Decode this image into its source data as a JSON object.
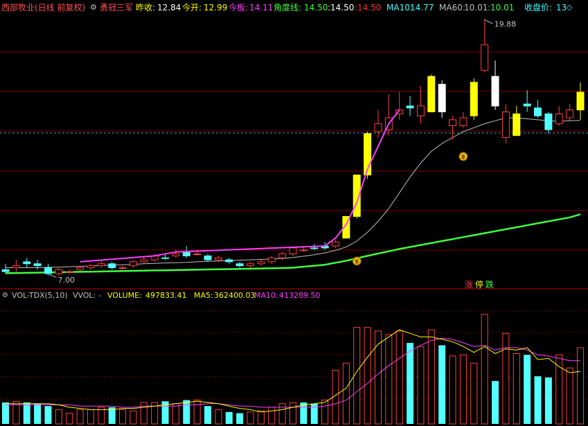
{
  "header": {
    "stock_name": "西部牧业(日线 前复权)",
    "strategy_icon": "gear-icon",
    "strategy_name": "勇冠三军",
    "prev_close_label": "昨收:",
    "prev_close_value": "12.84",
    "open_label": "今开:",
    "open_value": "12.99",
    "limit_label": "今板:",
    "limit_value": "14.11",
    "angle_label": "角度线:",
    "angle_value": "14.50",
    "colon_value": ":14.50",
    "val_red": ":14.50",
    "ma10_label": "MA10:",
    "ma10_value": "14.77",
    "ma60_label": "MA60:",
    "ma60_value": "10.01",
    "val_green": ":10.01",
    "close_label": "收盘价:",
    "close_value": "13",
    "diamond_icon": "diamond-icon"
  },
  "annotations": {
    "high_label": "19.88",
    "low_label": "7.00",
    "buy_icon": "money-bag-icon",
    "zhang": "涨",
    "ting": "停",
    "die": "跌"
  },
  "volume_header": {
    "title": "VOL-TDX(5,10)",
    "vvol": "VVOL: -",
    "volume_label": "VOLUME:",
    "volume_value": "497833.41",
    "ma5_label": "MA5:",
    "ma5_value": "362400.03",
    "ma10_label": "MA10:",
    "ma10_value": "413289.50"
  },
  "colors": {
    "up": "#ff4040",
    "down": "#54ffff",
    "yellow": "#ffff00",
    "white": "#ffffff",
    "ma60": "#40ff40",
    "angle": "#ff3fff",
    "grid": "#800000"
  },
  "chart_data": {
    "type": "candlestick",
    "price_scale": {
      "min": 7.0,
      "max": 20.1
    },
    "candles": [
      {
        "o": 7.2,
        "c": 7.1,
        "h": 7.5,
        "l": 7.0,
        "k": "down"
      },
      {
        "o": 7.3,
        "c": 7.4,
        "h": 7.7,
        "l": 7.1,
        "k": "up"
      },
      {
        "o": 7.6,
        "c": 7.5,
        "h": 7.8,
        "l": 7.3,
        "k": "down"
      },
      {
        "o": 7.5,
        "c": 7.4,
        "h": 7.7,
        "l": 7.2,
        "k": "down"
      },
      {
        "o": 7.3,
        "c": 7.0,
        "h": 7.5,
        "l": 6.9,
        "k": "down"
      },
      {
        "o": 7.0,
        "c": 7.2,
        "h": 7.3,
        "l": 6.9,
        "k": "up"
      },
      {
        "o": 7.1,
        "c": 7.1,
        "h": 7.2,
        "l": 7.0,
        "k": "up"
      },
      {
        "o": 7.2,
        "c": 7.3,
        "h": 7.4,
        "l": 7.1,
        "k": "up"
      },
      {
        "o": 7.3,
        "c": 7.4,
        "h": 7.5,
        "l": 7.2,
        "k": "up"
      },
      {
        "o": 7.4,
        "c": 7.5,
        "h": 7.7,
        "l": 7.3,
        "k": "up"
      },
      {
        "o": 7.5,
        "c": 7.3,
        "h": 7.6,
        "l": 7.2,
        "k": "down"
      },
      {
        "o": 7.3,
        "c": 7.3,
        "h": 7.4,
        "l": 7.2,
        "k": "up"
      },
      {
        "o": 7.4,
        "c": 7.6,
        "h": 7.7,
        "l": 7.3,
        "k": "up"
      },
      {
        "o": 7.6,
        "c": 7.7,
        "h": 7.9,
        "l": 7.5,
        "k": "up"
      },
      {
        "o": 7.7,
        "c": 7.9,
        "h": 8.0,
        "l": 7.6,
        "k": "up"
      },
      {
        "o": 7.8,
        "c": 7.8,
        "h": 8.0,
        "l": 7.7,
        "k": "down"
      },
      {
        "o": 7.9,
        "c": 8.0,
        "h": 8.2,
        "l": 7.8,
        "k": "up"
      },
      {
        "o": 7.9,
        "c": 8.1,
        "h": 8.4,
        "l": 7.8,
        "k": "down"
      },
      {
        "o": 8.0,
        "c": 8.0,
        "h": 8.2,
        "l": 7.9,
        "k": "up"
      },
      {
        "o": 7.9,
        "c": 7.7,
        "h": 8.0,
        "l": 7.6,
        "k": "down"
      },
      {
        "o": 7.7,
        "c": 7.8,
        "h": 7.9,
        "l": 7.6,
        "k": "up"
      },
      {
        "o": 7.7,
        "c": 7.6,
        "h": 7.8,
        "l": 7.5,
        "k": "down"
      },
      {
        "o": 7.5,
        "c": 7.4,
        "h": 7.6,
        "l": 7.3,
        "k": "down"
      },
      {
        "o": 7.4,
        "c": 7.5,
        "h": 7.6,
        "l": 7.3,
        "k": "up"
      },
      {
        "o": 7.5,
        "c": 7.6,
        "h": 7.7,
        "l": 7.4,
        "k": "up"
      },
      {
        "o": 7.6,
        "c": 7.8,
        "h": 7.9,
        "l": 7.5,
        "k": "up"
      },
      {
        "o": 7.8,
        "c": 8.0,
        "h": 8.1,
        "l": 7.7,
        "k": "up"
      },
      {
        "o": 8.0,
        "c": 8.3,
        "h": 8.4,
        "l": 7.9,
        "k": "up"
      },
      {
        "o": 8.2,
        "c": 8.2,
        "h": 8.4,
        "l": 8.1,
        "k": "up"
      },
      {
        "o": 8.3,
        "c": 8.3,
        "h": 8.5,
        "l": 8.2,
        "k": "down"
      },
      {
        "o": 8.3,
        "c": 8.4,
        "h": 8.6,
        "l": 8.2,
        "k": "down"
      },
      {
        "o": 8.4,
        "c": 8.6,
        "h": 8.7,
        "l": 8.3,
        "k": "up"
      },
      {
        "o": 8.8,
        "c": 9.9,
        "h": 9.9,
        "l": 8.8,
        "k": "yellow"
      },
      {
        "o": 9.9,
        "c": 12.0,
        "h": 12.0,
        "l": 9.8,
        "k": "yellow"
      },
      {
        "o": 12.0,
        "c": 14.1,
        "h": 14.2,
        "l": 11.8,
        "k": "yellow"
      },
      {
        "o": 14.2,
        "c": 14.6,
        "h": 15.3,
        "l": 13.9,
        "k": "up"
      },
      {
        "o": 14.3,
        "c": 14.9,
        "h": 16.1,
        "l": 14.0,
        "k": "up"
      },
      {
        "o": 15.1,
        "c": 15.3,
        "h": 16.2,
        "l": 14.8,
        "k": "up"
      },
      {
        "o": 15.5,
        "c": 15.4,
        "h": 16.0,
        "l": 15.0,
        "k": "down"
      },
      {
        "o": 15.0,
        "c": 15.5,
        "h": 16.5,
        "l": 14.6,
        "k": "up"
      },
      {
        "o": 15.2,
        "c": 17.0,
        "h": 17.1,
        "l": 15.2,
        "k": "yellow"
      },
      {
        "o": 16.6,
        "c": 15.2,
        "h": 16.8,
        "l": 14.9,
        "k": "white"
      },
      {
        "o": 14.8,
        "c": 14.5,
        "h": 15.0,
        "l": 13.8,
        "k": "up"
      },
      {
        "o": 14.5,
        "c": 14.9,
        "h": 15.2,
        "l": 14.4,
        "k": "up"
      },
      {
        "o": 15.0,
        "c": 16.7,
        "h": 16.9,
        "l": 14.8,
        "k": "yellow"
      },
      {
        "o": 18.6,
        "c": 17.3,
        "h": 19.88,
        "l": 17.2,
        "k": "up"
      },
      {
        "o": 17.0,
        "c": 15.5,
        "h": 17.8,
        "l": 15.3,
        "k": "white"
      },
      {
        "o": 15.2,
        "c": 13.9,
        "h": 15.6,
        "l": 13.6,
        "k": "up"
      },
      {
        "o": 14.0,
        "c": 15.1,
        "h": 15.5,
        "l": 14.0,
        "k": "yellow"
      },
      {
        "o": 15.6,
        "c": 15.5,
        "h": 16.3,
        "l": 15.2,
        "k": "down"
      },
      {
        "o": 15.4,
        "c": 15.0,
        "h": 15.8,
        "l": 14.9,
        "k": "down"
      },
      {
        "o": 15.1,
        "c": 14.3,
        "h": 15.2,
        "l": 14.1,
        "k": "down"
      },
      {
        "o": 14.6,
        "c": 15.1,
        "h": 15.5,
        "l": 14.5,
        "k": "up"
      },
      {
        "o": 14.9,
        "c": 15.3,
        "h": 15.6,
        "l": 14.7,
        "k": "up"
      },
      {
        "o": 15.3,
        "c": 16.2,
        "h": 16.7,
        "l": 14.8,
        "k": "yellow"
      }
    ],
    "ma60": [
      7.02,
      7.03,
      7.04,
      7.05,
      7.06,
      7.07,
      7.08,
      7.09,
      7.1,
      7.11,
      7.12,
      7.13,
      7.14,
      7.15,
      7.16,
      7.17,
      7.18,
      7.19,
      7.2,
      7.21,
      7.22,
      7.23,
      7.24,
      7.25,
      7.26,
      7.27,
      7.28,
      7.3,
      7.35,
      7.4,
      7.45,
      7.55,
      7.65,
      7.78,
      7.9,
      8.02,
      8.13,
      8.25,
      8.35,
      8.45,
      8.55,
      8.65,
      8.75,
      8.85,
      8.95,
      9.05,
      9.15,
      9.25,
      9.35,
      9.45,
      9.55,
      9.65,
      9.75,
      9.85,
      10.01
    ],
    "ma10": [
      7.3,
      7.3,
      7.3,
      7.3,
      7.32,
      7.33,
      7.35,
      7.37,
      7.39,
      7.41,
      7.43,
      7.45,
      7.47,
      7.5,
      7.52,
      7.54,
      7.55,
      7.57,
      7.6,
      7.62,
      7.64,
      7.66,
      7.68,
      7.7,
      7.72,
      7.74,
      7.77,
      7.82,
      7.88,
      7.96,
      8.05,
      8.18,
      8.35,
      8.65,
      9.1,
      9.65,
      10.3,
      11.1,
      11.9,
      12.6,
      13.2,
      13.6,
      13.9,
      14.2,
      14.4,
      14.6,
      14.75,
      14.9,
      14.9,
      14.85,
      14.8,
      14.75,
      14.72,
      14.75,
      14.77
    ],
    "angle_line": [
      {
        "i": 7,
        "v": 7.6
      },
      {
        "i": 14,
        "v": 7.9
      },
      {
        "i": 16,
        "v": 8.1
      },
      {
        "i": 30,
        "v": 8.4
      },
      {
        "i": 31,
        "v": 8.8
      },
      {
        "i": 32,
        "v": 9.5
      },
      {
        "i": 33,
        "v": 10.6
      },
      {
        "i": 34,
        "v": 12.3
      },
      {
        "i": 36,
        "v": 14.6
      },
      {
        "i": 37,
        "v": 15.3
      }
    ],
    "volume": [
      {
        "v": 0.18,
        "k": "down"
      },
      {
        "v": 0.19,
        "k": "up"
      },
      {
        "v": 0.18,
        "k": "down"
      },
      {
        "v": 0.17,
        "k": "down"
      },
      {
        "v": 0.15,
        "k": "down"
      },
      {
        "v": 0.12,
        "k": "up"
      },
      {
        "v": 0.09,
        "k": "up"
      },
      {
        "v": 0.12,
        "k": "up"
      },
      {
        "v": 0.12,
        "k": "up"
      },
      {
        "v": 0.14,
        "k": "up"
      },
      {
        "v": 0.14,
        "k": "down"
      },
      {
        "v": 0.12,
        "k": "up"
      },
      {
        "v": 0.11,
        "k": "up"
      },
      {
        "v": 0.18,
        "k": "up"
      },
      {
        "v": 0.18,
        "k": "up"
      },
      {
        "v": 0.19,
        "k": "down"
      },
      {
        "v": 0.17,
        "k": "up"
      },
      {
        "v": 0.2,
        "k": "down"
      },
      {
        "v": 0.2,
        "k": "up"
      },
      {
        "v": 0.15,
        "k": "down"
      },
      {
        "v": 0.12,
        "k": "up"
      },
      {
        "v": 0.1,
        "k": "down"
      },
      {
        "v": 0.09,
        "k": "down"
      },
      {
        "v": 0.1,
        "k": "up"
      },
      {
        "v": 0.11,
        "k": "up"
      },
      {
        "v": 0.14,
        "k": "up"
      },
      {
        "v": 0.17,
        "k": "up"
      },
      {
        "v": 0.18,
        "k": "up"
      },
      {
        "v": 0.18,
        "k": "down"
      },
      {
        "v": 0.17,
        "k": "down"
      },
      {
        "v": 0.2,
        "k": "up"
      },
      {
        "v": 0.45,
        "k": "up"
      },
      {
        "v": 0.51,
        "k": "up"
      },
      {
        "v": 0.81,
        "k": "up"
      },
      {
        "v": 0.81,
        "k": "up"
      },
      {
        "v": 0.78,
        "k": "up"
      },
      {
        "v": 0.75,
        "k": "up"
      },
      {
        "v": 0.78,
        "k": "up"
      },
      {
        "v": 0.68,
        "k": "down"
      },
      {
        "v": 0.65,
        "k": "up"
      },
      {
        "v": 0.79,
        "k": "up"
      },
      {
        "v": 0.66,
        "k": "down"
      },
      {
        "v": 0.57,
        "k": "up"
      },
      {
        "v": 0.58,
        "k": "up"
      },
      {
        "v": 0.51,
        "k": "up"
      },
      {
        "v": 0.92,
        "k": "up"
      },
      {
        "v": 0.36,
        "k": "down"
      },
      {
        "v": 0.76,
        "k": "up"
      },
      {
        "v": 0.59,
        "k": "up"
      },
      {
        "v": 0.58,
        "k": "down"
      },
      {
        "v": 0.4,
        "k": "down"
      },
      {
        "v": 0.39,
        "k": "down"
      },
      {
        "v": 0.58,
        "k": "up"
      },
      {
        "v": 0.47,
        "k": "up"
      },
      {
        "v": 0.64,
        "k": "up"
      }
    ],
    "vol_ma5": [
      0.17,
      0.17,
      0.17,
      0.17,
      0.17,
      0.16,
      0.14,
      0.13,
      0.12,
      0.12,
      0.12,
      0.13,
      0.13,
      0.14,
      0.15,
      0.16,
      0.17,
      0.18,
      0.19,
      0.18,
      0.17,
      0.15,
      0.13,
      0.12,
      0.1,
      0.11,
      0.12,
      0.14,
      0.16,
      0.17,
      0.18,
      0.24,
      0.3,
      0.44,
      0.56,
      0.67,
      0.73,
      0.79,
      0.76,
      0.73,
      0.73,
      0.71,
      0.69,
      0.65,
      0.6,
      0.65,
      0.59,
      0.63,
      0.62,
      0.64,
      0.54,
      0.55,
      0.48,
      0.43,
      0.44
    ],
    "vol_ma10": [
      0.16,
      0.16,
      0.16,
      0.16,
      0.16,
      0.16,
      0.16,
      0.15,
      0.15,
      0.15,
      0.15,
      0.14,
      0.14,
      0.15,
      0.15,
      0.15,
      0.15,
      0.16,
      0.16,
      0.17,
      0.17,
      0.16,
      0.15,
      0.15,
      0.14,
      0.14,
      0.14,
      0.14,
      0.14,
      0.14,
      0.15,
      0.17,
      0.2,
      0.27,
      0.34,
      0.42,
      0.49,
      0.55,
      0.61,
      0.66,
      0.7,
      0.72,
      0.71,
      0.68,
      0.65,
      0.66,
      0.62,
      0.64,
      0.64,
      0.62,
      0.58,
      0.57,
      0.55,
      0.53,
      0.53
    ]
  }
}
